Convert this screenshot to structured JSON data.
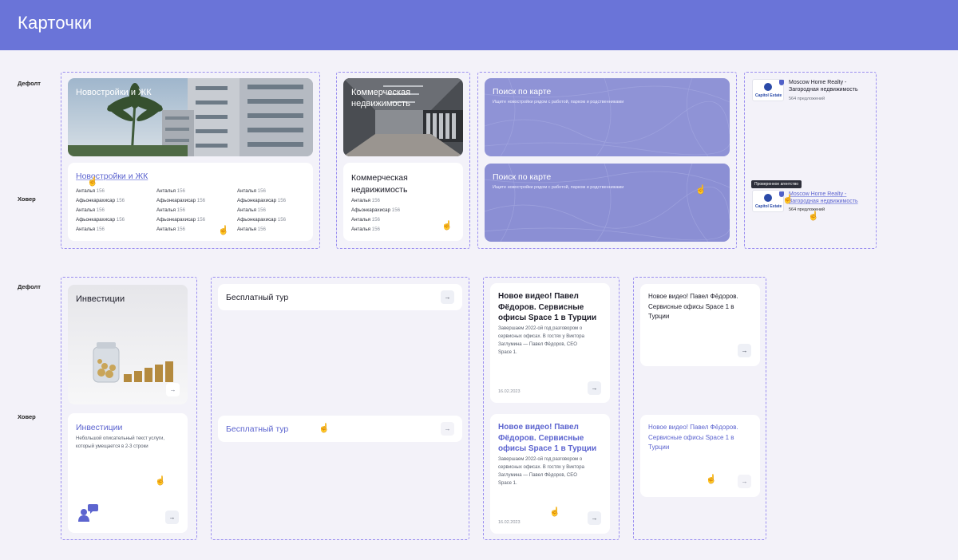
{
  "page": {
    "title": "Карточки"
  },
  "row_labels": {
    "default": "Дефолт",
    "hover": "Ховер"
  },
  "colors": {
    "accent": "#6a74d8",
    "hover_text": "#5c64cf",
    "dash": "#9b8ff0",
    "map": "#8f93d6"
  },
  "novostroyki": {
    "image_title": "Новостройки и ЖК",
    "hover_title": "Новостройки и ЖК",
    "columns": [
      [
        {
          "name": "Анталья",
          "count": "156"
        },
        {
          "name": "Афьонкарахисар",
          "count": "156"
        },
        {
          "name": "Анталья",
          "count": "156"
        },
        {
          "name": "Афьонкарахисар",
          "count": "156"
        },
        {
          "name": "Анталья",
          "count": "156"
        }
      ],
      [
        {
          "name": "Анталья",
          "count": "156"
        },
        {
          "name": "Афьонкарахисар",
          "count": "156"
        },
        {
          "name": "Анталья",
          "count": "156"
        },
        {
          "name": "Афьонкарахисар",
          "count": "156"
        },
        {
          "name": "Анталья",
          "count": "156"
        }
      ],
      [
        {
          "name": "Анталья",
          "count": "156"
        },
        {
          "name": "Афьонкарахисар",
          "count": "156"
        },
        {
          "name": "Анталья",
          "count": "156"
        },
        {
          "name": "Афьонкарахисар",
          "count": "156"
        },
        {
          "name": "Анталья",
          "count": "156"
        }
      ]
    ]
  },
  "commercial": {
    "image_title_1": "Коммерческая",
    "image_title_2": "недвижимость",
    "hover_title_1": "Коммерческая",
    "hover_title_2": "недвижимость",
    "items": [
      {
        "name": "Анталья",
        "count": "156"
      },
      {
        "name": "Афьонкарахисар",
        "count": "156"
      },
      {
        "name": "Анталья",
        "count": "156"
      },
      {
        "name": "Анталья",
        "count": "156"
      }
    ]
  },
  "map_search": {
    "title": "Поиск по карте",
    "subtitle": "Ищите новостройки рядом с работой, парком и родственниками"
  },
  "agency": {
    "logo_text": "Capitol Estate",
    "name_1": "Moscow Home Realty -",
    "name_2": "Загородная недвижимость",
    "offers": "564 предложений",
    "tooltip": "Проверенное агентство"
  },
  "investments": {
    "title": "Инвестиции",
    "hover_title": "Инвестиции",
    "desc_1": "Небольшой описательный текст услуги,",
    "desc_2": "который умещается в 2-3 строки",
    "arrow": "→"
  },
  "free_tour": {
    "title": "Бесплатный тур",
    "arrow": "→"
  },
  "video_card": {
    "title_1": "Новое видео! Павел",
    "title_2": "Фёдоров. Сервисные",
    "title_3": "офисы Space 1 в Турции",
    "text_1": "Завершаем 2022-ой год разговором о",
    "text_2": "сервисных офисах. В гостях у Виктора",
    "text_3": "Заглумина — Павел Фёдоров, CEO",
    "text_4": "Space 1.",
    "date": "16.02.2023",
    "arrow": "→"
  },
  "video_small": {
    "title_1": "Новое видео! Павел Фёдоров.",
    "title_2": "Сервисные офисы Space 1 в",
    "title_3": "Турции",
    "arrow": "→"
  }
}
